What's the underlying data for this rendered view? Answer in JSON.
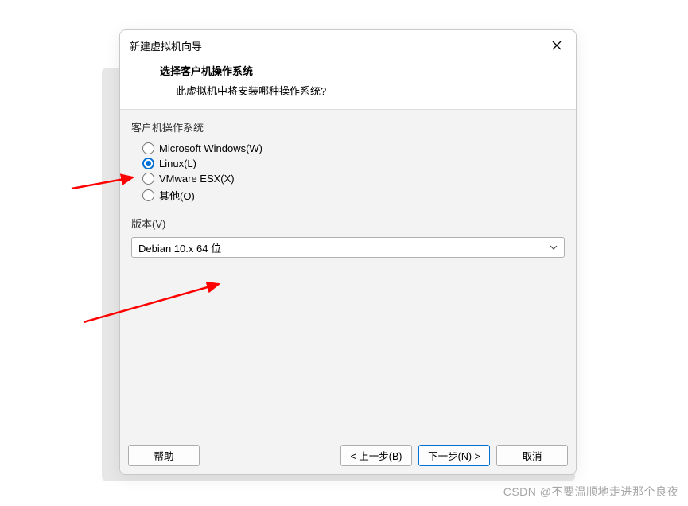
{
  "dialog": {
    "title": "新建虚拟机向导",
    "header_title": "选择客户机操作系统",
    "header_subtitle": "此虚拟机中将安装哪种操作系统?"
  },
  "os_section": {
    "label": "客户机操作系统",
    "options": [
      {
        "label": "Microsoft Windows(W)",
        "selected": false
      },
      {
        "label": "Linux(L)",
        "selected": true
      },
      {
        "label": "VMware ESX(X)",
        "selected": false
      },
      {
        "label": "其他(O)",
        "selected": false
      }
    ]
  },
  "version_section": {
    "label": "版本(V)",
    "selected": "Debian 10.x 64 位"
  },
  "footer": {
    "help": "帮助",
    "back": "< 上一步(B)",
    "next": "下一步(N) >",
    "cancel": "取消"
  },
  "watermark": "CSDN @不要温顺地走进那个良夜"
}
